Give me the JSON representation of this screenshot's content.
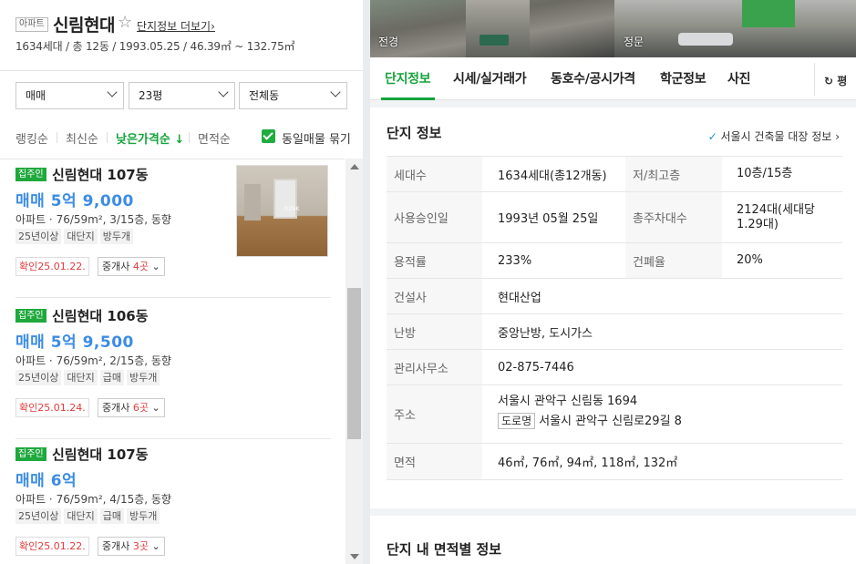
{
  "header": {
    "type_badge": "아파트",
    "complex_name": "신림현대",
    "more_link": "단지정보 더보기",
    "more_arrow": "›",
    "summary": "1634세대 / 총 12동 / 1993.05.25 / 46.39㎡ ~ 132.75㎡"
  },
  "filters": {
    "trade_type": "매매",
    "area": "23평",
    "dong": "전체동"
  },
  "sort": {
    "options": [
      "랭킹순",
      "최신순",
      "낮은가격순 ↓",
      "면적순"
    ],
    "active_index": 2,
    "group_same_label": "동일매물 묶기",
    "group_same_checked": true
  },
  "listings": [
    {
      "badge": "집주인",
      "building": "신림현대 107동",
      "price": "매매 5억 9,000",
      "info": "아파트 · 76/59m², 3/15층, 동향",
      "tags": [
        "25년이상",
        "대단지",
        "방두개"
      ],
      "confirmed": "확인25.01.22.",
      "agent_prefix": "중개사 ",
      "agent_count": "4곳",
      "has_photo": true,
      "photo_watermark": "R2NK"
    },
    {
      "badge": "집주인",
      "building": "신림현대 106동",
      "price": "매매 5억 9,500",
      "info": "아파트 · 76/59m², 2/15층, 동향",
      "tags": [
        "25년이상",
        "대단지",
        "급매",
        "방두개"
      ],
      "confirmed": "확인25.01.24.",
      "agent_prefix": "중개사 ",
      "agent_count": "6곳",
      "has_photo": false
    },
    {
      "badge": "집주인",
      "building": "신림현대 107동",
      "price": "매매 6억",
      "info": "아파트 · 76/59m², 4/15층, 동향",
      "tags": [
        "25년이상",
        "대단지",
        "급매",
        "방두개"
      ],
      "confirmed": "확인25.01.22.",
      "agent_prefix": "중개사 ",
      "agent_count": "3곳",
      "has_photo": false
    }
  ],
  "photos": {
    "left_label": "전경",
    "right_label": "정문"
  },
  "tabs": [
    "단지정보",
    "시세/실거래가",
    "동호수/공시가격",
    "학군정보",
    "사진"
  ],
  "active_tab": 0,
  "unit_toggle": "평",
  "complex_info": {
    "title": "단지 정보",
    "link": "서울시 건축물 대장 정보",
    "link_arrow": "›",
    "rows": {
      "households_key": "세대수",
      "households_val": "1634세대(총12개동)",
      "floors_key": "저/최고층",
      "floors_val": "10층/15층",
      "approval_key": "사용승인일",
      "approval_val": "1993년 05월 25일",
      "parking_key": "총주차대수",
      "parking_val": "2124대(세대당 1.29대)",
      "far_key": "용적률",
      "far_val": "233%",
      "bcr_key": "건폐율",
      "bcr_val": "20%",
      "builder_key": "건설사",
      "builder_val": "현대산업",
      "heating_key": "난방",
      "heating_val": "중앙난방, 도시가스",
      "office_key": "관리사무소",
      "office_val": "02-875-7446",
      "address_key": "주소",
      "address_lot": "서울시 관악구 신림동 1694",
      "road_badge": "도로명",
      "address_road": "서울시 관악구 신림로29길 8",
      "area_key": "면적",
      "area_val": "46㎡, 76㎡, 94㎡, 118㎡, 132㎡"
    }
  },
  "area_info": {
    "title": "단지 내 면적별 정보"
  }
}
